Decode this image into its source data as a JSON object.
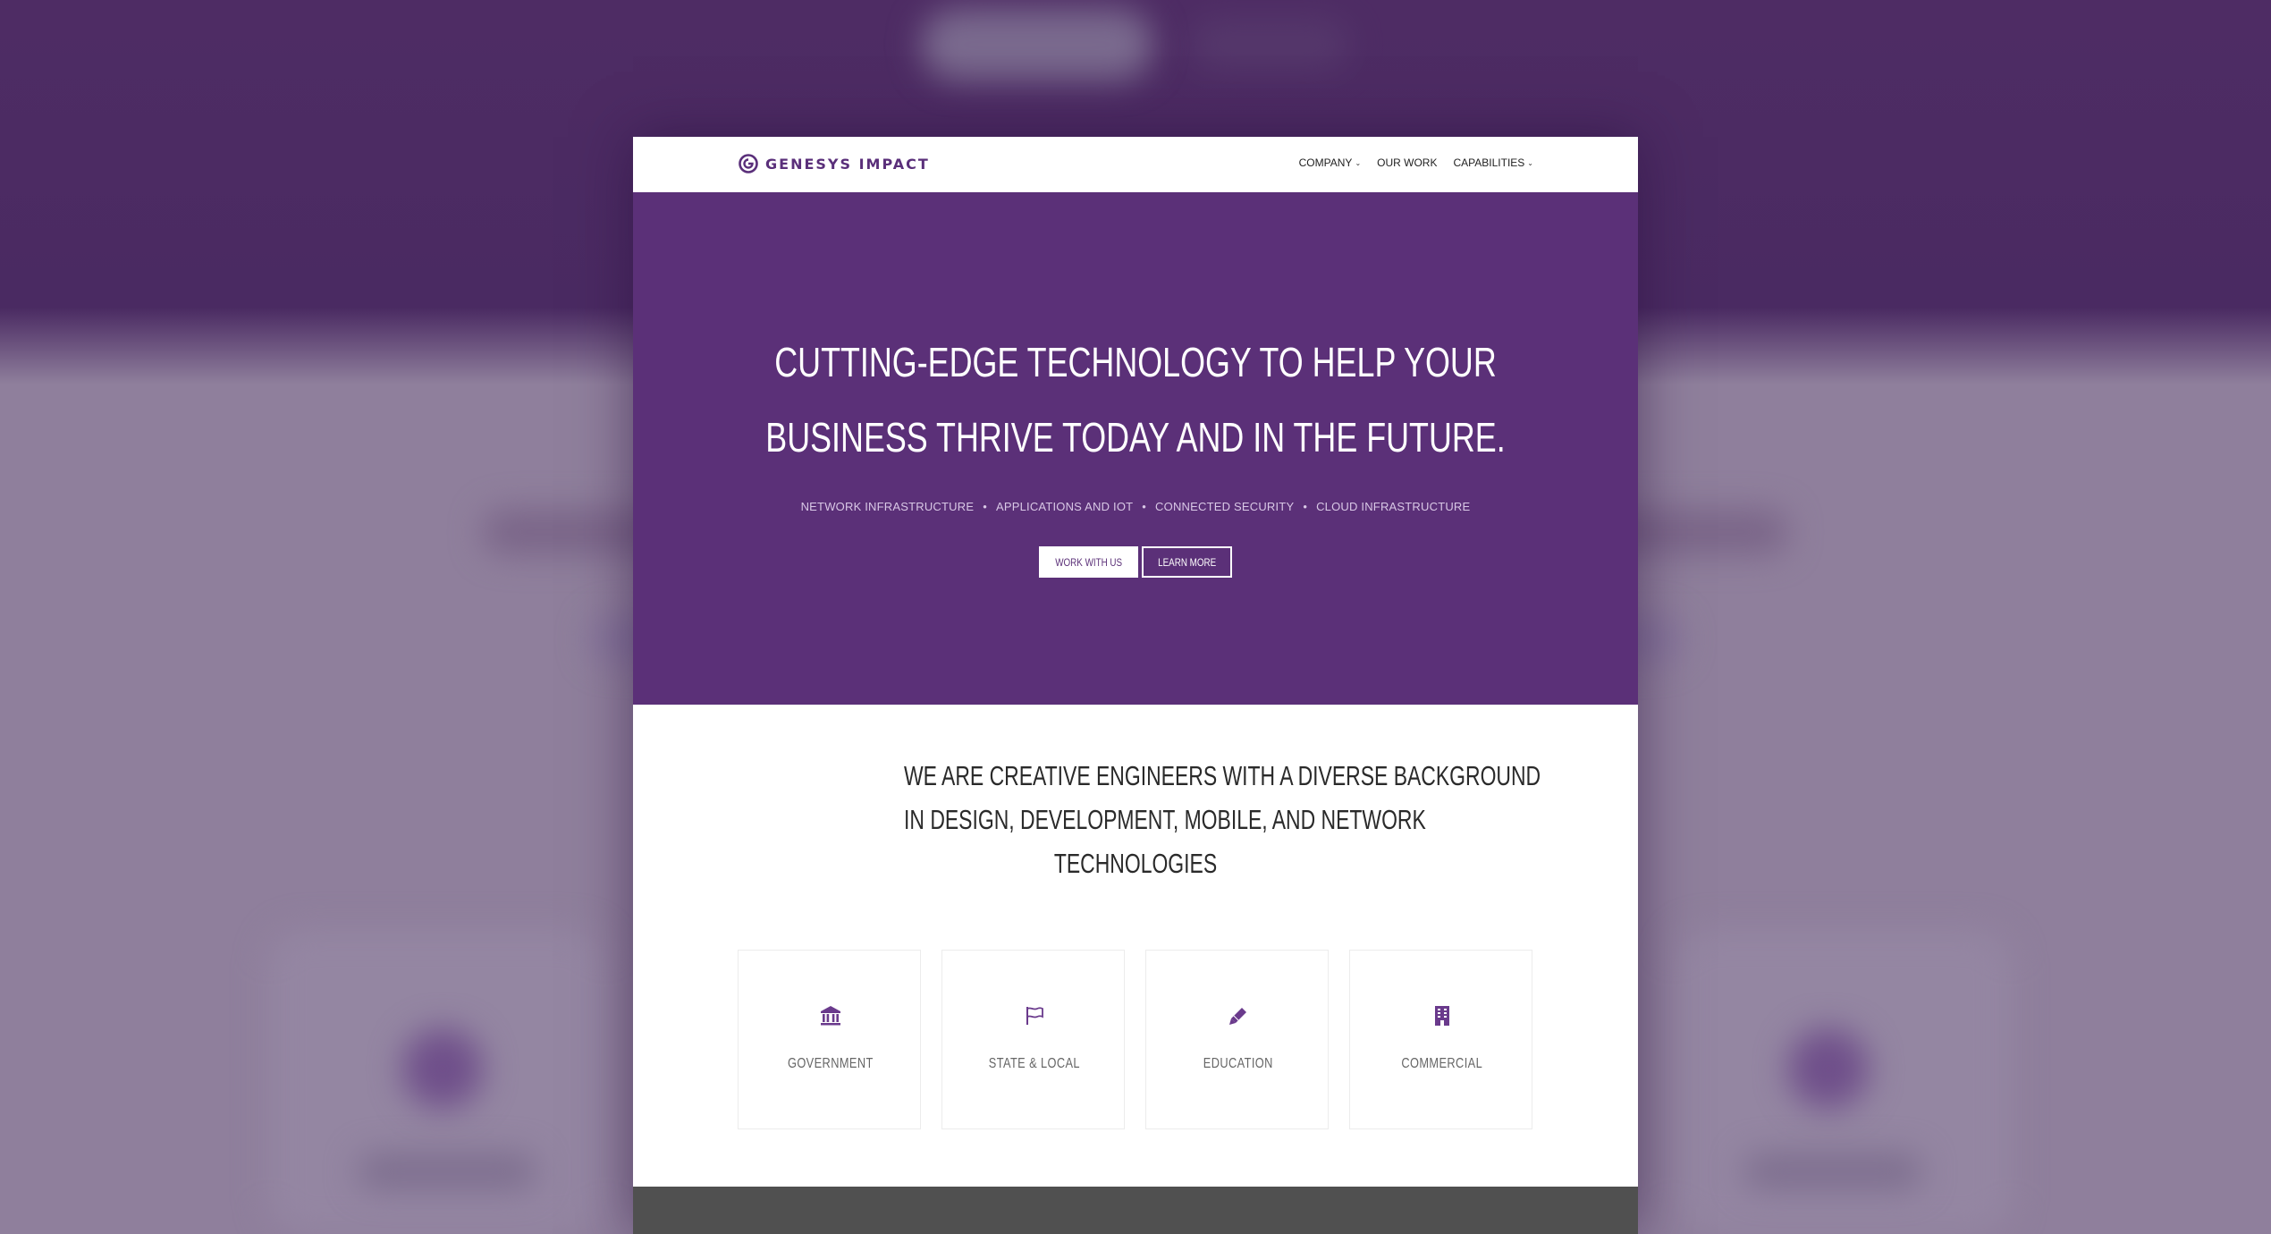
{
  "brand": {
    "name": "GENESYS IMPACT",
    "color": "#5a2f7a"
  },
  "nav": {
    "items": [
      {
        "label": "COMPANY",
        "dropdown": true
      },
      {
        "label": "OUR WORK",
        "dropdown": false
      },
      {
        "label": "CAPABILITIES",
        "dropdown": true
      }
    ]
  },
  "hero": {
    "title_lines": [
      "CUTTING-EDGE TECHNOLOGY TO HELP YOUR",
      "BUSINESS THRIVE TODAY AND IN THE FUTURE."
    ],
    "tags": [
      "NETWORK INFRASTRUCTURE",
      "APPLICATIONS AND IOT",
      "CONNECTED SECURITY",
      "CLOUD INFRASTRUCTURE"
    ],
    "tag_separator": "•",
    "primary_button": "WORK WITH US",
    "secondary_button": "LEARN MORE",
    "background_color": "#5b3078"
  },
  "intro": {
    "title_lines": [
      "WE ARE CREATIVE ENGINEERS WITH A DIVERSE BACKGROUND",
      "IN DESIGN, DEVELOPMENT, MOBILE, AND NETWORK",
      "TECHNOLOGIES"
    ]
  },
  "cards": [
    {
      "label": "GOVERNMENT",
      "icon": "bank-icon"
    },
    {
      "label": "STATE & LOCAL",
      "icon": "flag-icon"
    },
    {
      "label": "EDUCATION",
      "icon": "pencil-icon"
    },
    {
      "label": "COMMERCIAL",
      "icon": "building-icon"
    }
  ],
  "colors": {
    "accent": "#6a3a8c",
    "footer": "#505050",
    "backdrop_top": "#4a2a62",
    "backdrop_bottom": "#8f7f9c"
  }
}
